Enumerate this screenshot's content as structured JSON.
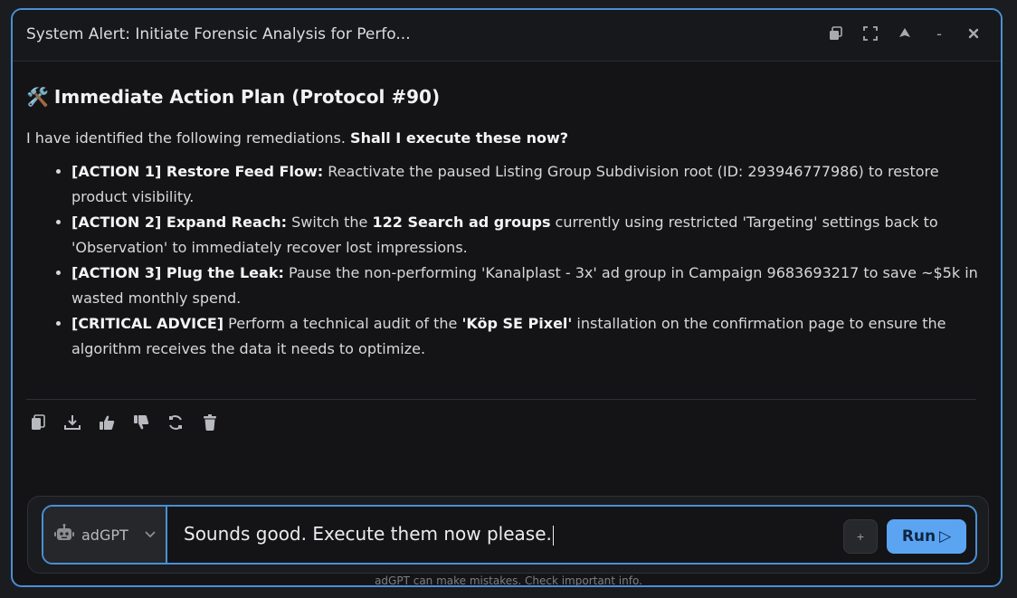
{
  "window": {
    "title": "System Alert: Initiate Forensic Analysis for Perfo...",
    "controls": [
      "restore-icon",
      "fullscreen-icon",
      "pin-icon",
      "minimize-icon",
      "close-icon"
    ],
    "minimize_label": "-"
  },
  "message": {
    "heading_emoji": "🛠️",
    "heading": "Immediate Action Plan (Protocol #90)",
    "intro_text": "I have identified the following remediations. ",
    "intro_bold": "Shall I execute these now?",
    "actions": [
      {
        "label": "[ACTION 1] Restore Feed Flow:",
        "text": " Reactivate the paused Listing Group Subdivision root (ID: 293946777986) to restore product visibility."
      },
      {
        "label": "[ACTION 2] Expand Reach:",
        "pre": " Switch the ",
        "bold": "122 Search ad groups",
        "post": " currently using restricted 'Targeting' settings back to 'Observation' to immediately recover lost impressions."
      },
      {
        "label": "[ACTION 3] Plug the Leak:",
        "text": " Pause the non-performing 'Kanalplast - 3x' ad group in Campaign 9683693217 to save ~$5k in wasted monthly spend."
      },
      {
        "label": "[CRITICAL ADVICE]",
        "pre": " Perform a technical audit of the ",
        "bold": "'Köp SE Pixel'",
        "post": " installation on the confirmation page to ensure the algorithm receives the data it needs to optimize."
      }
    ],
    "tools": [
      "copy-icon",
      "download-icon",
      "thumbs-up-icon",
      "thumbs-down-icon",
      "regenerate-icon",
      "delete-icon"
    ]
  },
  "composer": {
    "model": "adGPT",
    "input_value": "Sounds good. Execute them now please.",
    "plus_label": "+",
    "run_label": "Run",
    "run_icon": "▷"
  },
  "disclaimer": "adGPT can make mistakes. Check important info.",
  "colors": {
    "accent": "#4a8fd6",
    "run_button": "#5ba4f2",
    "background": "#141416"
  }
}
